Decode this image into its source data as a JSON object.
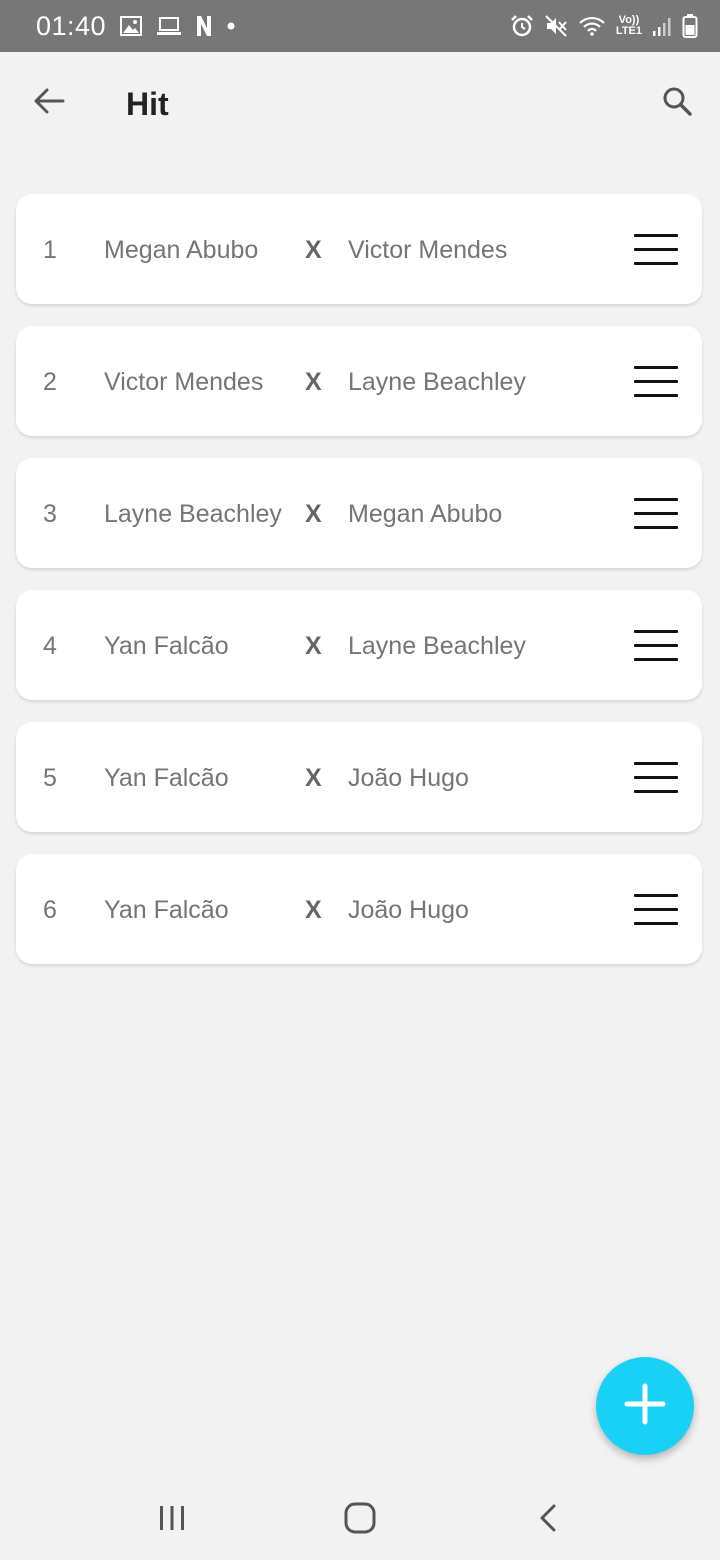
{
  "status_bar": {
    "time": "01:40",
    "icons_left": [
      "image-icon",
      "laptop-icon",
      "netflix-icon",
      "dot-icon"
    ],
    "icons_right": [
      "alarm-icon",
      "mute-icon",
      "wifi-icon",
      "volte-icon",
      "signal-icon",
      "battery-icon"
    ],
    "volte_top": "Vo))",
    "volte_bottom": "LTE1"
  },
  "app_bar": {
    "title": "Hit"
  },
  "heats": [
    {
      "number": "1",
      "surfer_a": "Megan Abubo",
      "versus": "X",
      "surfer_b": "Victor Mendes"
    },
    {
      "number": "2",
      "surfer_a": "Victor Mendes",
      "versus": "X",
      "surfer_b": "Layne Beachley"
    },
    {
      "number": "3",
      "surfer_a": "Layne Beachley",
      "versus": "X",
      "surfer_b": "Megan Abubo"
    },
    {
      "number": "4",
      "surfer_a": "Yan Falcão",
      "versus": "X",
      "surfer_b": "Layne Beachley"
    },
    {
      "number": "5",
      "surfer_a": "Yan Falcão",
      "versus": "X",
      "surfer_b": "João Hugo"
    },
    {
      "number": "6",
      "surfer_a": "Yan Falcão",
      "versus": "X",
      "surfer_b": "João Hugo"
    }
  ],
  "colors": {
    "fab": "#19d1f6",
    "status_bar": "#777777",
    "background": "#f2f2f2"
  },
  "fab_icon": "plus-icon",
  "nav_bar": {
    "icons": [
      "recent-apps-icon",
      "home-icon",
      "back-nav-icon"
    ]
  }
}
